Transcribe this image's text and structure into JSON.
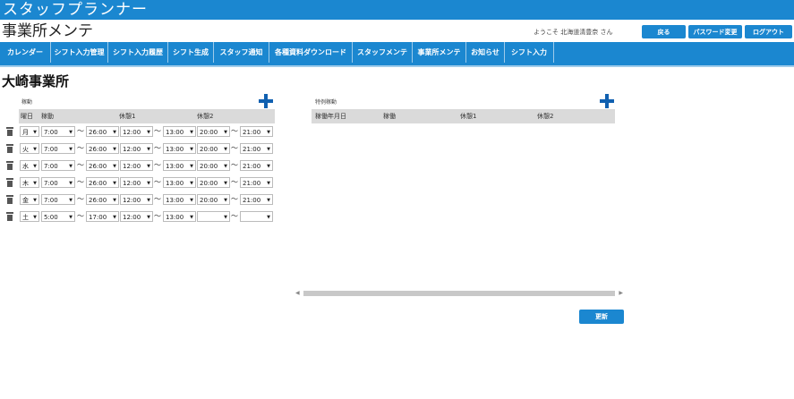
{
  "app": {
    "title": "スタッフプランナー"
  },
  "page": {
    "title": "事業所メンテ"
  },
  "header": {
    "welcome": "ようこそ 北海道清豊奈 さん",
    "back_label": "戻る",
    "password_label": "パスワード変更",
    "logout_label": "ログアウト"
  },
  "menu": {
    "items": [
      {
        "label": "カレンダー"
      },
      {
        "label": "シフト入力管理"
      },
      {
        "label": "シフト入力履歴"
      },
      {
        "label": "シフト生成"
      },
      {
        "label": "スタッフ通知"
      },
      {
        "label": "各種資料ダウンロード"
      },
      {
        "label": "スタッフメンテ"
      },
      {
        "label": "事業所メンテ"
      },
      {
        "label": "お知らせ"
      },
      {
        "label": "シフト入力"
      }
    ]
  },
  "office": {
    "name": "大崎事業所"
  },
  "operation": {
    "section_label": "稼動",
    "headers": {
      "day": "曜日",
      "work": "稼動",
      "break1": "休憩1",
      "break2": "休憩2"
    },
    "tilde": "～",
    "rows": [
      {
        "day": "月",
        "start": "7:00",
        "end": "26:00",
        "b1s": "12:00",
        "b1e": "13:00",
        "b2s": "20:00",
        "b2e": "21:00"
      },
      {
        "day": "火",
        "start": "7:00",
        "end": "26:00",
        "b1s": "12:00",
        "b1e": "13:00",
        "b2s": "20:00",
        "b2e": "21:00"
      },
      {
        "day": "水",
        "start": "7:00",
        "end": "26:00",
        "b1s": "12:00",
        "b1e": "13:00",
        "b2s": "20:00",
        "b2e": "21:00"
      },
      {
        "day": "木",
        "start": "7:00",
        "end": "26:00",
        "b1s": "12:00",
        "b1e": "13:00",
        "b2s": "20:00",
        "b2e": "21:00"
      },
      {
        "day": "金",
        "start": "7:00",
        "end": "26:00",
        "b1s": "12:00",
        "b1e": "13:00",
        "b2s": "20:00",
        "b2e": "21:00"
      },
      {
        "day": "土",
        "start": "5:00",
        "end": "17:00",
        "b1s": "12:00",
        "b1e": "13:00",
        "b2s": "",
        "b2e": ""
      }
    ]
  },
  "special": {
    "section_label": "特例稼動",
    "headers": {
      "date": "稼働年月日",
      "work": "稼働",
      "break1": "休憩1",
      "break2": "休憩2"
    }
  },
  "actions": {
    "update_label": "更新"
  }
}
